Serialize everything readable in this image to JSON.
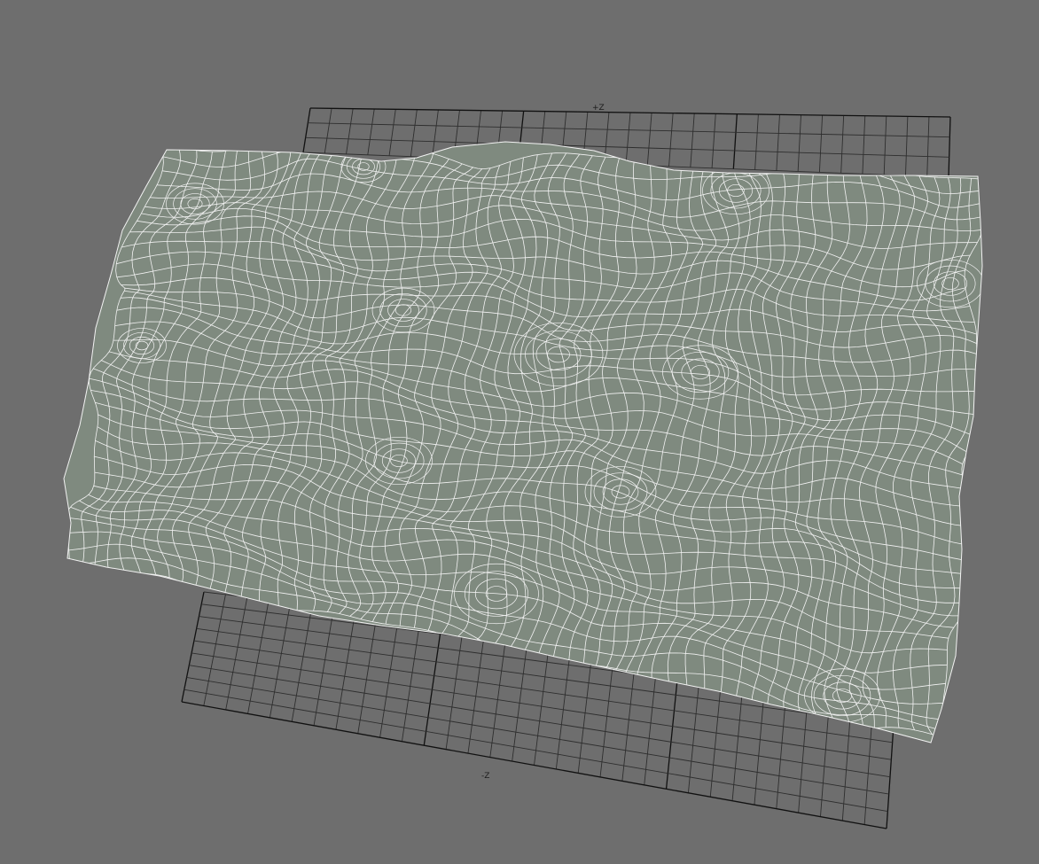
{
  "viewport": {
    "background": "#6e6e6e",
    "grid": {
      "line_color": "#2e2e2e",
      "major_line_color": "#111111",
      "axis_labels": {
        "far": "+Z",
        "near": "-Z"
      }
    },
    "mesh": {
      "fill_color": "#7f8a7f",
      "wire_color": "#f2f2f2"
    }
  }
}
